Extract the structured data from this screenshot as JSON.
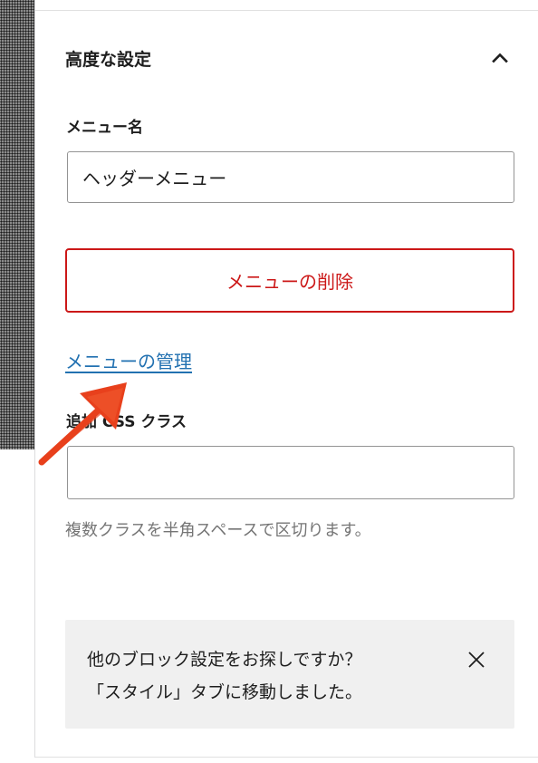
{
  "panel": {
    "title": "高度な設定",
    "expand_icon": "chevron-up-icon"
  },
  "menu_name": {
    "label": "メニュー名",
    "value": "ヘッダーメニュー"
  },
  "delete_button": {
    "label": "メニューの削除",
    "color": "#cc1818"
  },
  "manage_link": {
    "label": "メニューの管理",
    "color": "#2271b1"
  },
  "css_class": {
    "label": "追加 CSS クラス",
    "value": "",
    "help": "複数クラスを半角スペースで区切ります。"
  },
  "notice": {
    "line1": "他のブロック設定をお探しですか？",
    "line2": "「スタイル」タブに移動しました。",
    "close_icon": "close-icon"
  },
  "annotation": {
    "arrow_color": "#e8401c"
  }
}
